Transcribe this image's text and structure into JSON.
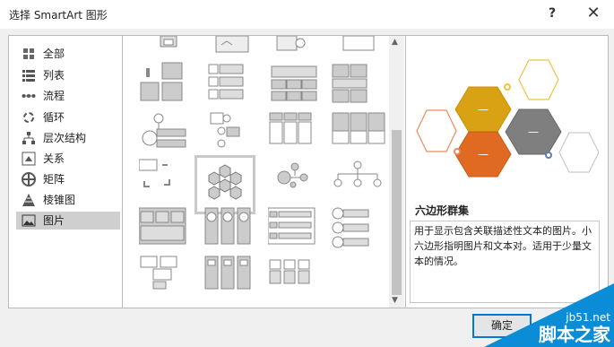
{
  "window": {
    "title": "选择 SmartArt 图形",
    "help_label": "?",
    "close_label": "✕"
  },
  "categories": [
    {
      "label": "全部",
      "icon": "all-icon"
    },
    {
      "label": "列表",
      "icon": "list-icon"
    },
    {
      "label": "流程",
      "icon": "process-icon"
    },
    {
      "label": "循环",
      "icon": "cycle-icon"
    },
    {
      "label": "层次结构",
      "icon": "hierarchy-icon"
    },
    {
      "label": "关系",
      "icon": "relationship-icon"
    },
    {
      "label": "矩阵",
      "icon": "matrix-icon"
    },
    {
      "label": "棱锥图",
      "icon": "pyramid-icon"
    },
    {
      "label": "图片",
      "icon": "picture-icon"
    }
  ],
  "selected_category": "图片",
  "preview": {
    "name": "六边形群集",
    "description": "用于显示包含关联描述性文本的图片。小六边形指明图片和文本对。适用于少量文本的情况。"
  },
  "ok_label": "确定",
  "watermark": {
    "site": "jb51.net",
    "name": "脚本之家"
  }
}
